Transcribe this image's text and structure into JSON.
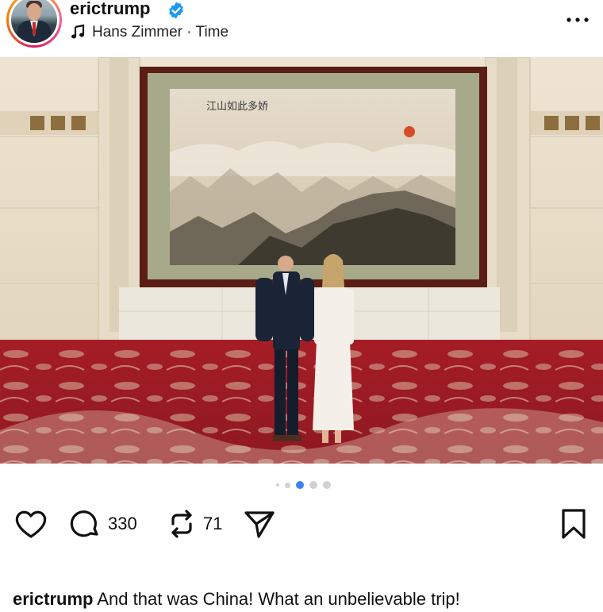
{
  "post": {
    "username": "erictrump",
    "verified": true,
    "audio": "Hans Zimmer · Time",
    "icons": {
      "audio": "music-note-icon",
      "more": "more-horizontal-icon",
      "sound": "speaker-icon",
      "like": "heart-icon",
      "comment": "comment-icon",
      "repost": "repost-icon",
      "share": "send-icon",
      "save": "bookmark-icon"
    },
    "carousel": {
      "total_visible_dots": 5,
      "active_index": 2
    }
  },
  "actions": {
    "comments": "330",
    "reposts": "71"
  },
  "caption": {
    "username": "erictrump",
    "text": " And that was China! What an unbelievable trip!"
  },
  "colors": {
    "accent": "#3b82f6",
    "verified": "#1d9bf0",
    "carpet": "#b3202a",
    "frame": "#5a1e14"
  }
}
